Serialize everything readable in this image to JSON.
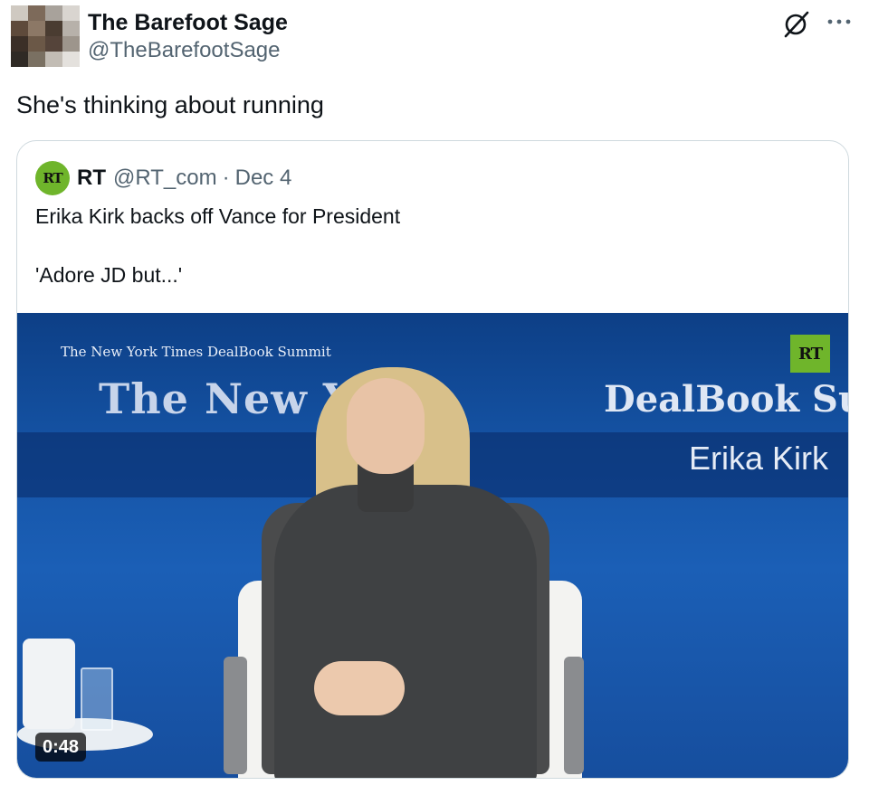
{
  "post": {
    "author_name": "The Barefoot Sage",
    "author_handle": "@TheBarefootSage",
    "text": "She's thinking about running",
    "avatar_icon": "pixelated-avatar",
    "grok_icon": "grok-icon",
    "more_icon": "more-icon"
  },
  "quote": {
    "logo_text": "RT",
    "name": "RT",
    "handle": "@RT_com",
    "separator": "·",
    "date": "Dec 4",
    "text_line1": "Erika Kirk backs off Vance for President",
    "text_line2": "'Adore JD but...'",
    "video": {
      "duration": "0:48",
      "overlay_small": "The New York Times DealBook Summit",
      "overlay_big": "The New York",
      "overlay_dealbook": "DealBook Sum",
      "name_caption": "Erika Kirk",
      "badge": "RT"
    }
  },
  "colors": {
    "accent_green": "#6fb52b",
    "secondary_text": "#536471",
    "border": "#cfd9de"
  }
}
